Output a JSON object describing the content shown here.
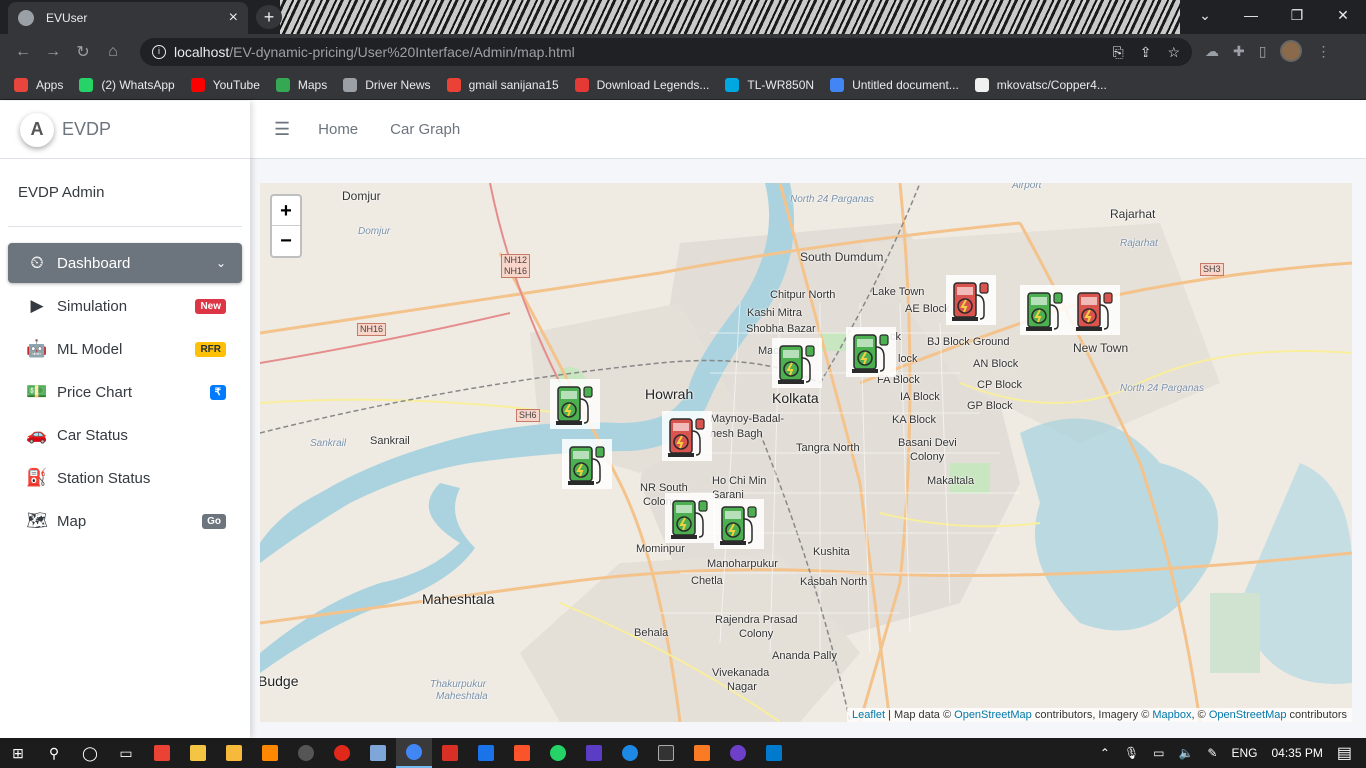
{
  "browser": {
    "tab_title": "EVUser",
    "tab_close": "×",
    "new_tab": "+",
    "url_host": "localhost",
    "url_path": "/EV-dynamic-pricing/User%20Interface/Admin/map.html",
    "window_controls": [
      "⌄",
      "—",
      "❐",
      "✕"
    ],
    "bookmarks": [
      {
        "label": "Apps",
        "color": "#e8453c"
      },
      {
        "label": "(2) WhatsApp",
        "color": "#25d366"
      },
      {
        "label": "YouTube",
        "color": "#ff0000"
      },
      {
        "label": "Maps",
        "color": "#34a853"
      },
      {
        "label": "Driver News",
        "color": "#9aa0a6"
      },
      {
        "label": "gmail sanijana15",
        "color": "#ea4335"
      },
      {
        "label": "Download Legends...",
        "color": "#e53935"
      },
      {
        "label": "TL-WR850N",
        "color": "#00a7e1"
      },
      {
        "label": "Untitled document...",
        "color": "#4285f4"
      },
      {
        "label": "mkovatsc/Copper4...",
        "color": "#f0f0f0"
      }
    ]
  },
  "sidebar": {
    "brand": "EVDP",
    "brand_logo": "A",
    "user": "EVDP Admin",
    "items": [
      {
        "label": "Dashboard",
        "icon": "⏲",
        "active": true,
        "chevron": "⌄"
      },
      {
        "label": "Simulation",
        "icon": "▶",
        "badge": "New",
        "badge_color": "red"
      },
      {
        "label": "ML Model",
        "icon": "🤖",
        "badge": "RFR",
        "badge_color": "yellow"
      },
      {
        "label": "Price Chart",
        "icon": "💵",
        "badge": "₹",
        "badge_color": "blue"
      },
      {
        "label": "Car Status",
        "icon": "🚗",
        "badge": ""
      },
      {
        "label": "Station Status",
        "icon": "⛽",
        "badge": ""
      },
      {
        "label": "Map",
        "icon": "🗺",
        "badge": "Go",
        "badge_color": "gray"
      }
    ]
  },
  "topnav": {
    "menu_icon": "☰",
    "links": [
      "Home",
      "Car Graph"
    ]
  },
  "map": {
    "zoom_in": "+",
    "zoom_out": "−",
    "labels": {
      "domjur": "Domjur",
      "domjur_river": "Domjur",
      "north24": "North 24 Parganas",
      "airport": "Airport",
      "rajarhat": "Rajarhat",
      "rajarhat_it": "Rajarhat",
      "south_dumdum": "South Dumdum",
      "lake_town": "Lake Town",
      "ae_block": "AE Block",
      "chitpur": "Chitpur North",
      "kashi_mitra": "Kashi Mitra",
      "shobha": "Shobha Bazar",
      "bj_block": "BJ Block Ground",
      "new_town": "New Town",
      "an_block": "AN Block",
      "cp_block": "CP Block",
      "gp_block": "GP Block",
      "north24b": "North 24 Parganas",
      "howrah": "Howrah",
      "kolkata": "Kolkata",
      "ia_block": "IA Block",
      "ka_block": "KA Block",
      "fa_block": "FA Block",
      "tangra": "Tangra North",
      "basani": "Basani Devi",
      "basani2": "Colony",
      "sankrail": "Sankrail",
      "sankrail_it": "Sankrail",
      "nr_south": "NR South",
      "colony": "Colony",
      "hochimin": "Ho Chi Min",
      "sarani": "Sarani",
      "makaltala": "Makaltala",
      "mominpur": "Mominpur",
      "kushita": "Kushita",
      "manoharpukur": "Manoharpukur",
      "chetla": "Chetla",
      "kasbah": "Kasbah North",
      "maheshtala": "Maheshtala",
      "rajendra": "Rajendra Prasad",
      "rajendra2": "Colony",
      "behala": "Behala",
      "ananda": "Ananda Pally",
      "vivekanada": "Vivekanada",
      "nagar": "Nagar",
      "budge": "Budge",
      "thakurpukur": "Thakurpukur",
      "thakurpukur2": "Maheshtala",
      "mach": "Mach",
      "block": "lock",
      "ck": "ck",
      "haya": "Maynoy-Badal-",
      "nesh": "nesh Bagh"
    },
    "shields": [
      "NH12",
      "NH16",
      "NH16",
      "SH6",
      "SH3"
    ],
    "attribution": {
      "leaflet": "Leaflet",
      "text1": " | Map data © ",
      "osm": "OpenStreetMap",
      "text2": " contributors, Imagery © ",
      "mapbox": "Mapbox",
      "text3": ", © ",
      "osm2": "OpenStreetMap",
      "text4": " contributors"
    },
    "markers": [
      {
        "status": "available",
        "color": "#4caf50"
      },
      {
        "status": "busy",
        "color": "#d9534f"
      }
    ]
  },
  "taskbar": {
    "lang": "ENG",
    "time": "04:35 PM"
  }
}
